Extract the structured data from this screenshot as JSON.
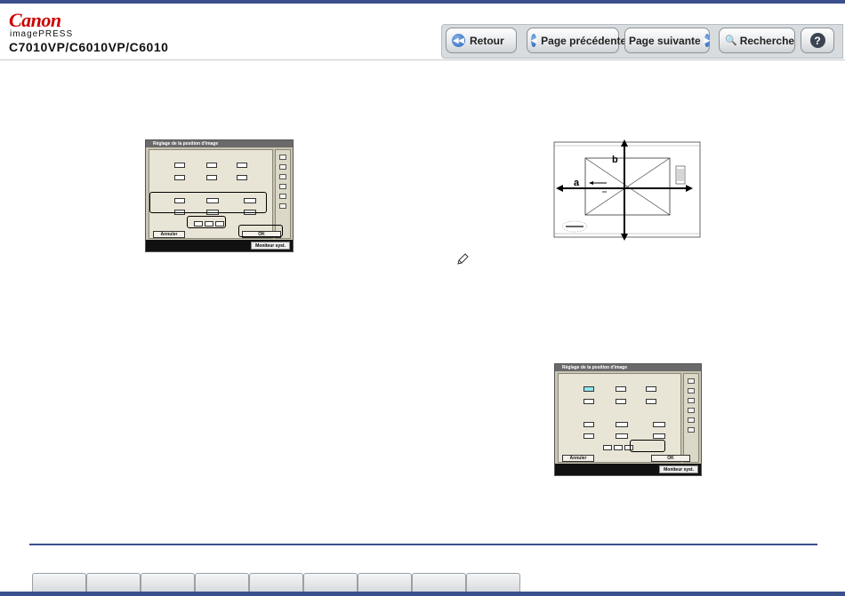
{
  "header": {
    "brand": "Canon",
    "product": "imagePRESS",
    "model": "C7010VP/C6010VP/C6010"
  },
  "nav": {
    "back": "Retour",
    "prev": "Page précédente",
    "next": "Page suivante",
    "search": "Recherche",
    "help": "?"
  },
  "screen1": {
    "title": "Réglage de la position d'image",
    "cancel": "Annuler",
    "ok": "OK",
    "monitor": "Moniteur syst."
  },
  "screen2": {
    "title": "Réglage de la position d'image",
    "cancel": "Annuler",
    "ok": "OK",
    "monitor": "Moniteur syst."
  },
  "diagram": {
    "label_a": "a",
    "label_b": "b"
  },
  "footer": {
    "tabs": [
      "",
      "",
      "",
      "",
      "",
      "",
      "",
      "",
      ""
    ]
  }
}
